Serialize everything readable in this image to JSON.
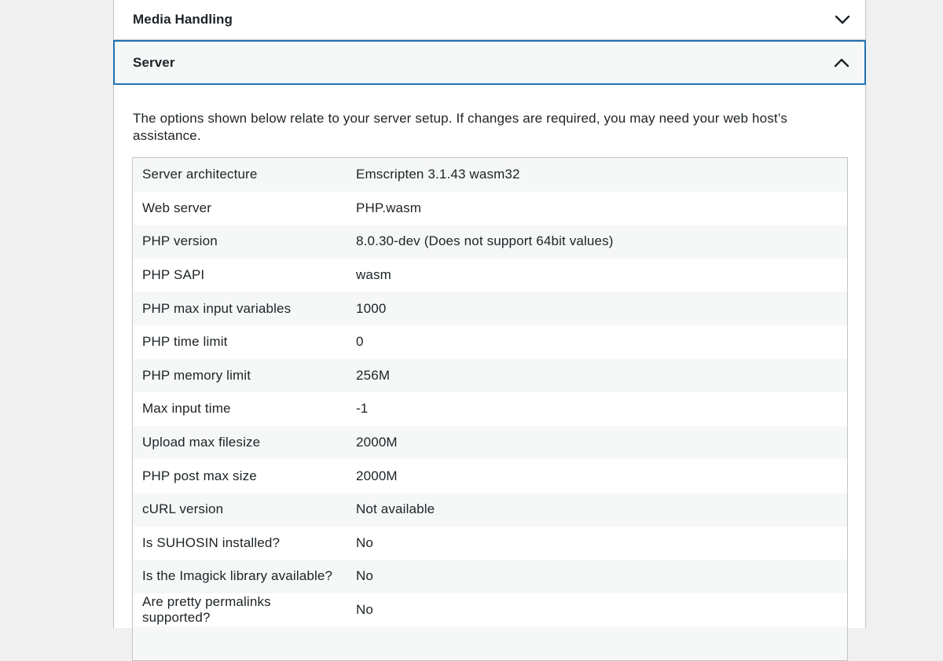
{
  "sections": {
    "media": {
      "title": "Media Handling",
      "toggle_icon": "chevron-down-icon"
    },
    "server": {
      "title": "Server",
      "toggle_icon": "chevron-up-icon",
      "intro": "The options shown below relate to your server setup. If changes are required, you may need your web host’s assistance.",
      "rows": [
        {
          "label": "Server architecture",
          "value": "Emscripten 3.1.43 wasm32"
        },
        {
          "label": "Web server",
          "value": "PHP.wasm"
        },
        {
          "label": "PHP version",
          "value": "8.0.30-dev (Does not support 64bit values)"
        },
        {
          "label": "PHP SAPI",
          "value": "wasm"
        },
        {
          "label": "PHP max input variables",
          "value": "1000"
        },
        {
          "label": "PHP time limit",
          "value": "0"
        },
        {
          "label": "PHP memory limit",
          "value": "256M"
        },
        {
          "label": "Max input time",
          "value": "-1"
        },
        {
          "label": "Upload max filesize",
          "value": "2000M"
        },
        {
          "label": "PHP post max size",
          "value": "2000M"
        },
        {
          "label": "cURL version",
          "value": "Not available"
        },
        {
          "label": "Is SUHOSIN installed?",
          "value": "No"
        },
        {
          "label": "Is the Imagick library available?",
          "value": "No"
        },
        {
          "label": "Are pretty permalinks supported?",
          "value": "No"
        },
        {
          "label": "",
          "value": ""
        }
      ]
    }
  },
  "colors": {
    "focus_border": "#2271b1",
    "row_alt": "#f6f7f7",
    "border": "#c3c4c7",
    "text": "#1d2327"
  }
}
